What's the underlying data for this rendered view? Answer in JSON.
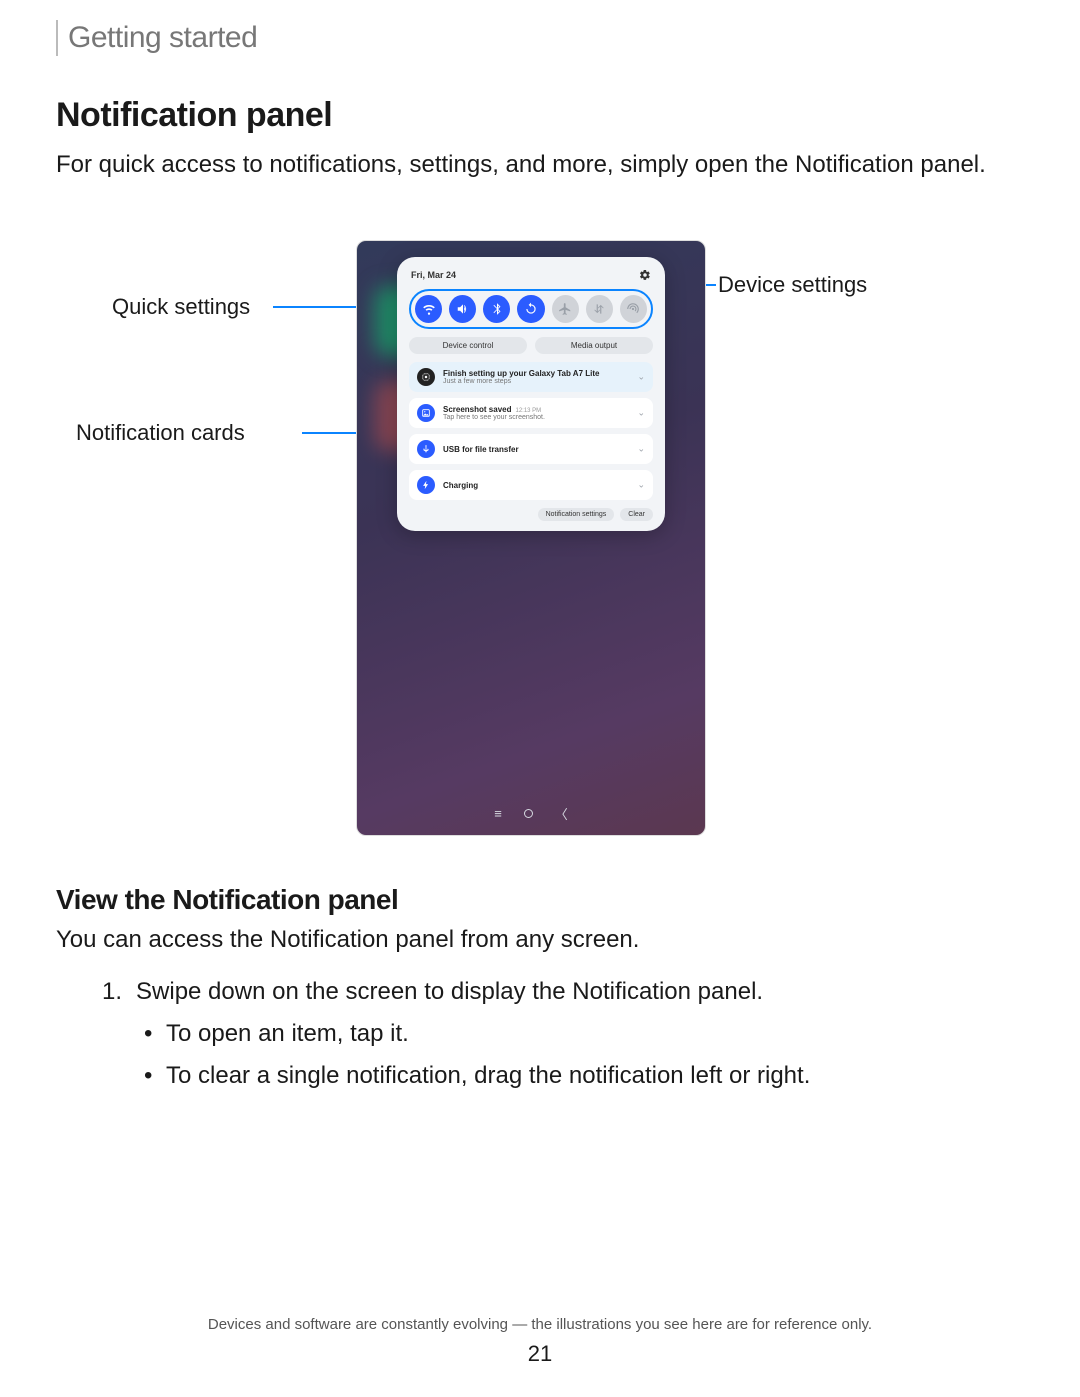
{
  "breadcrumb": "Getting started",
  "title": "Notification panel",
  "intro": "For quick access to notifications, settings, and more, simply open the Notification panel.",
  "callouts": {
    "quick_settings": "Quick settings",
    "notification_cards": "Notification cards",
    "device_settings": "Device settings"
  },
  "shade": {
    "date": "Fri, Mar 24",
    "qs_icons": [
      "wifi",
      "volume",
      "bluetooth",
      "rotate",
      "airplane",
      "data",
      "hotspot"
    ],
    "qs_states": [
      true,
      true,
      true,
      true,
      false,
      false,
      false
    ],
    "segments": {
      "device_control": "Device control",
      "media_output": "Media output"
    },
    "notifications": [
      {
        "icon": "gear",
        "icon_bg": "#222",
        "title": "Finish setting up your Galaxy Tab A7 Lite",
        "sub": "Just a few more steps",
        "highlight": true
      },
      {
        "icon": "image",
        "icon_bg": "#2b5cff",
        "title": "Screenshot saved",
        "time": "12:13 PM",
        "sub": "Tap here to see your screenshot."
      },
      {
        "icon": "usb",
        "icon_bg": "#2b5cff",
        "title": "USB for file transfer"
      },
      {
        "icon": "bolt",
        "icon_bg": "#2b5cff",
        "title": "Charging"
      }
    ],
    "footer": {
      "settings": "Notification settings",
      "clear": "Clear"
    }
  },
  "section2": {
    "heading": "View the Notification panel",
    "lead": "You can access the Notification panel from any screen.",
    "step_num": "1.",
    "step": "Swipe down on the screen to display the Notification panel.",
    "bullets": [
      "To open an item, tap it.",
      "To clear a single notification, drag the notification left or right."
    ]
  },
  "footer_note": "Devices and software are constantly evolving — the illustrations you see here are for reference only.",
  "page_number": "21"
}
